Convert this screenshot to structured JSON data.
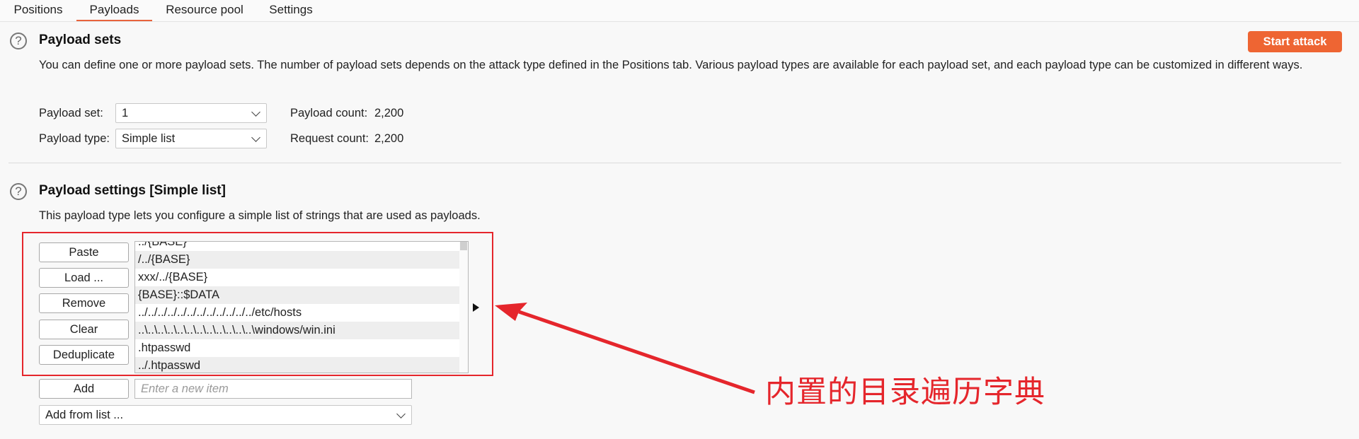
{
  "tabs": [
    {
      "label": "Positions"
    },
    {
      "label": "Payloads"
    },
    {
      "label": "Resource pool"
    },
    {
      "label": "Settings"
    }
  ],
  "active_tab": "Payloads",
  "payload_sets": {
    "title": "Payload sets",
    "description": "You can define one or more payload sets. The number of payload sets depends on the attack type defined in the Positions tab. Various payload types are available for each payload set, and each payload type can be customized in different ways.",
    "start_attack_label": "Start attack",
    "payload_set_label": "Payload set:",
    "payload_set_value": "1",
    "payload_type_label": "Payload type:",
    "payload_type_value": "Simple list",
    "payload_count_label": "Payload count:",
    "payload_count_value": "2,200",
    "request_count_label": "Request count:",
    "request_count_value": "2,200"
  },
  "payload_settings": {
    "title": "Payload settings [Simple list]",
    "description": "This payload type lets you configure a simple list of strings that are used as payloads.",
    "buttons": {
      "paste": "Paste",
      "load": "Load ...",
      "remove": "Remove",
      "clear": "Clear",
      "deduplicate": "Deduplicate",
      "add": "Add"
    },
    "list_items": [
      "../{BASE}",
      "/../{BASE}",
      "xxx/../{BASE}",
      "{BASE}::$DATA",
      "../../../../../../../../../../../../etc/hosts",
      "..\\..\\..\\..\\..\\..\\..\\..\\..\\..\\..\\..\\windows/win.ini",
      ".htpasswd",
      "../.htpasswd"
    ],
    "new_item_placeholder": "Enter a new item",
    "add_from_list_label": "Add from list ..."
  },
  "annotation": {
    "text": "内置的目录遍历字典",
    "color": "#e5262c"
  },
  "colors": {
    "accent": "#ee6533",
    "annotation": "#e5262c"
  }
}
